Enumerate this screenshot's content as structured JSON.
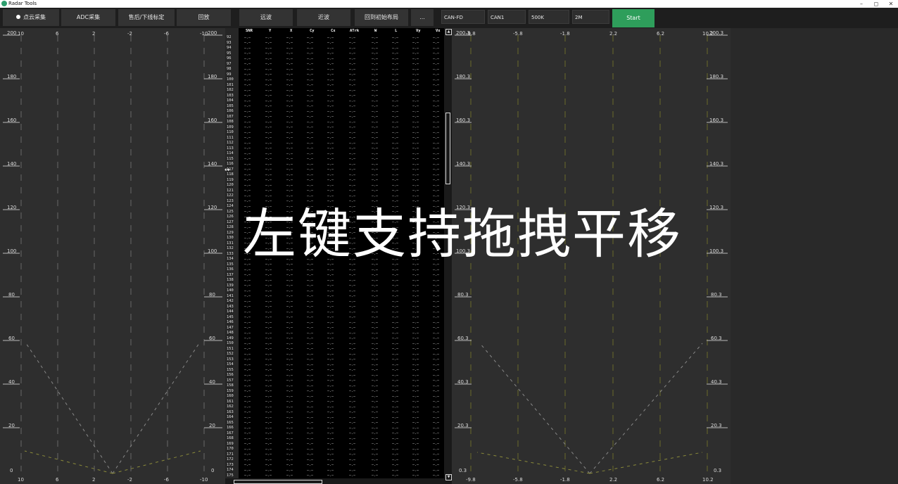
{
  "window": {
    "title": "Radar Tools",
    "controls": [
      "–",
      "◻",
      "✕"
    ]
  },
  "toolbar": {
    "buttons": [
      "点云采集",
      "ADC采集",
      "售后/下线标定",
      "回放",
      "远波",
      "近波",
      "回到初始布局",
      "..."
    ],
    "fields": [
      "CAN-FD",
      "CAN1",
      "500K",
      "2M"
    ],
    "start_label": "Start"
  },
  "left_plot": {
    "x_ticks": [
      "10",
      "6",
      "2",
      "-2",
      "-6",
      "-10"
    ],
    "y_ticks": [
      "200",
      "180",
      "160",
      "140",
      "120",
      "100",
      "80",
      "60",
      "40",
      "20",
      "0"
    ]
  },
  "right_plot": {
    "x_ticks": [
      "-9.8",
      "-5.8",
      "-1.8",
      "2.2",
      "6.2",
      "10.2"
    ],
    "y_ticks": [
      "200.3",
      "180.3",
      "160.3",
      "140.3",
      "120.3",
      "100.3",
      "80.3",
      "60.3",
      "40.3",
      "20.3",
      "0.3"
    ]
  },
  "table": {
    "headers": [
      "SNR",
      "Y",
      "X",
      "Cy",
      "Cx",
      "ATrk",
      "W",
      "L",
      "Vy",
      "Vx"
    ],
    "cell_text": "—.—",
    "row_start": 92,
    "row_end": 175
  },
  "overlay_caption": "左键支持拖拽平移"
}
